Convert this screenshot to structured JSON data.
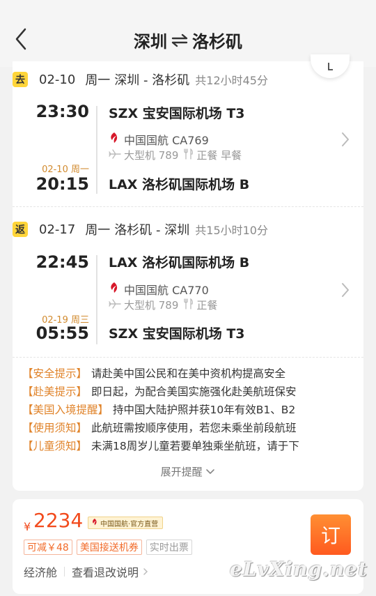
{
  "header": {
    "origin": "深圳",
    "destination": "洛杉矶"
  },
  "outbound": {
    "tag": "去",
    "date": "02-10",
    "weekday": "周一",
    "route": "深圳 - 洛杉矶",
    "duration": "共12小时45分",
    "depart_time": "23:30",
    "depart_airport": "SZX 宝安国际机场 T3",
    "airline": "中国国航 CA769",
    "aircraft": "大型机 789",
    "meal": "正餐 早餐",
    "arrive_date_note": "02-10 周一",
    "arrive_time": "20:15",
    "arrive_airport": "LAX 洛杉矶国际机场 B"
  },
  "inbound": {
    "tag": "返",
    "date": "02-17",
    "weekday": "周一",
    "route": "洛杉矶 - 深圳",
    "duration": "共15小时10分",
    "depart_time": "22:45",
    "depart_airport": "LAX 洛杉矶国际机场 B",
    "airline": "中国国航 CA770",
    "aircraft": "大型机 789",
    "meal": "正餐",
    "arrive_date_note": "02-19 周三",
    "arrive_time": "05:55",
    "arrive_airport": "SZX 宝安国际机场 T3"
  },
  "notices": [
    {
      "title": "【安全提示】",
      "text": "请赴美中国公民和在美中资机构提高安全"
    },
    {
      "title": "【赴美提示】",
      "text": "即日起，为配合美国实施强化赴美航班保安"
    },
    {
      "title": "【美国入境提醒】",
      "text": "持中国大陆护照并获10年有效B1、B2"
    },
    {
      "title": "【使用须知】",
      "text": "此航班需按顺序使用，若您未乘坐前段航班"
    },
    {
      "title": "【儿童须知】",
      "text": "未满18周岁儿童若要单独乘坐航班，请于下"
    }
  ],
  "expand_label": "展开提醒",
  "price": {
    "currency": "¥",
    "amount": "2234",
    "badge": "中国国航·官方直营",
    "tags": [
      "可减￥48",
      "美国接送机券",
      "实时出票"
    ],
    "cabin": "经济舱",
    "refund_link": "查看退改说明",
    "book_label": "订"
  },
  "watermark": "eLvXing.net",
  "colors": {
    "accent_orange": "#f24a1c",
    "tag_yellow": "#ffd53a",
    "notice_orange": "#e0832a",
    "airchina_red": "#d7182a"
  },
  "icons": {
    "back": "back-arrow-icon",
    "swap": "swap-arrows-icon",
    "airline_logo": "air-china-logo-icon",
    "plane": "plane-icon",
    "meal": "fork-knife-icon",
    "chevron": "chevron-right-icon"
  }
}
